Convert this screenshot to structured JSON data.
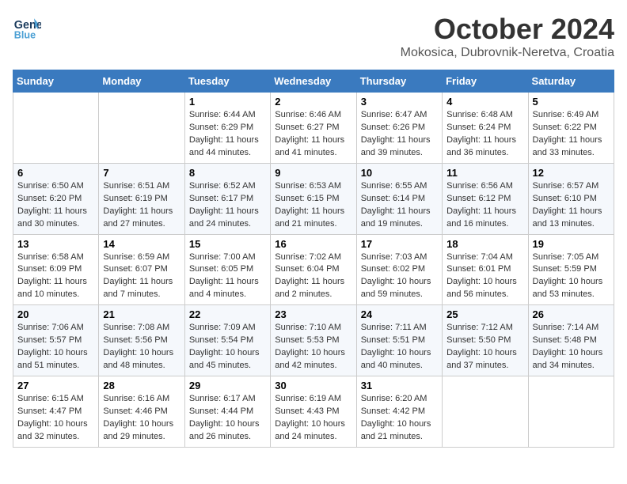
{
  "header": {
    "logo_line1": "General",
    "logo_line2": "Blue",
    "title": "October 2024",
    "location": "Mokosica, Dubrovnik-Neretva, Croatia"
  },
  "days_of_week": [
    "Sunday",
    "Monday",
    "Tuesday",
    "Wednesday",
    "Thursday",
    "Friday",
    "Saturday"
  ],
  "weeks": [
    [
      {
        "day": "",
        "sunrise": "",
        "sunset": "",
        "daylight": ""
      },
      {
        "day": "",
        "sunrise": "",
        "sunset": "",
        "daylight": ""
      },
      {
        "day": "1",
        "sunrise": "Sunrise: 6:44 AM",
        "sunset": "Sunset: 6:29 PM",
        "daylight": "Daylight: 11 hours and 44 minutes."
      },
      {
        "day": "2",
        "sunrise": "Sunrise: 6:46 AM",
        "sunset": "Sunset: 6:27 PM",
        "daylight": "Daylight: 11 hours and 41 minutes."
      },
      {
        "day": "3",
        "sunrise": "Sunrise: 6:47 AM",
        "sunset": "Sunset: 6:26 PM",
        "daylight": "Daylight: 11 hours and 39 minutes."
      },
      {
        "day": "4",
        "sunrise": "Sunrise: 6:48 AM",
        "sunset": "Sunset: 6:24 PM",
        "daylight": "Daylight: 11 hours and 36 minutes."
      },
      {
        "day": "5",
        "sunrise": "Sunrise: 6:49 AM",
        "sunset": "Sunset: 6:22 PM",
        "daylight": "Daylight: 11 hours and 33 minutes."
      }
    ],
    [
      {
        "day": "6",
        "sunrise": "Sunrise: 6:50 AM",
        "sunset": "Sunset: 6:20 PM",
        "daylight": "Daylight: 11 hours and 30 minutes."
      },
      {
        "day": "7",
        "sunrise": "Sunrise: 6:51 AM",
        "sunset": "Sunset: 6:19 PM",
        "daylight": "Daylight: 11 hours and 27 minutes."
      },
      {
        "day": "8",
        "sunrise": "Sunrise: 6:52 AM",
        "sunset": "Sunset: 6:17 PM",
        "daylight": "Daylight: 11 hours and 24 minutes."
      },
      {
        "day": "9",
        "sunrise": "Sunrise: 6:53 AM",
        "sunset": "Sunset: 6:15 PM",
        "daylight": "Daylight: 11 hours and 21 minutes."
      },
      {
        "day": "10",
        "sunrise": "Sunrise: 6:55 AM",
        "sunset": "Sunset: 6:14 PM",
        "daylight": "Daylight: 11 hours and 19 minutes."
      },
      {
        "day": "11",
        "sunrise": "Sunrise: 6:56 AM",
        "sunset": "Sunset: 6:12 PM",
        "daylight": "Daylight: 11 hours and 16 minutes."
      },
      {
        "day": "12",
        "sunrise": "Sunrise: 6:57 AM",
        "sunset": "Sunset: 6:10 PM",
        "daylight": "Daylight: 11 hours and 13 minutes."
      }
    ],
    [
      {
        "day": "13",
        "sunrise": "Sunrise: 6:58 AM",
        "sunset": "Sunset: 6:09 PM",
        "daylight": "Daylight: 11 hours and 10 minutes."
      },
      {
        "day": "14",
        "sunrise": "Sunrise: 6:59 AM",
        "sunset": "Sunset: 6:07 PM",
        "daylight": "Daylight: 11 hours and 7 minutes."
      },
      {
        "day": "15",
        "sunrise": "Sunrise: 7:00 AM",
        "sunset": "Sunset: 6:05 PM",
        "daylight": "Daylight: 11 hours and 4 minutes."
      },
      {
        "day": "16",
        "sunrise": "Sunrise: 7:02 AM",
        "sunset": "Sunset: 6:04 PM",
        "daylight": "Daylight: 11 hours and 2 minutes."
      },
      {
        "day": "17",
        "sunrise": "Sunrise: 7:03 AM",
        "sunset": "Sunset: 6:02 PM",
        "daylight": "Daylight: 10 hours and 59 minutes."
      },
      {
        "day": "18",
        "sunrise": "Sunrise: 7:04 AM",
        "sunset": "Sunset: 6:01 PM",
        "daylight": "Daylight: 10 hours and 56 minutes."
      },
      {
        "day": "19",
        "sunrise": "Sunrise: 7:05 AM",
        "sunset": "Sunset: 5:59 PM",
        "daylight": "Daylight: 10 hours and 53 minutes."
      }
    ],
    [
      {
        "day": "20",
        "sunrise": "Sunrise: 7:06 AM",
        "sunset": "Sunset: 5:57 PM",
        "daylight": "Daylight: 10 hours and 51 minutes."
      },
      {
        "day": "21",
        "sunrise": "Sunrise: 7:08 AM",
        "sunset": "Sunset: 5:56 PM",
        "daylight": "Daylight: 10 hours and 48 minutes."
      },
      {
        "day": "22",
        "sunrise": "Sunrise: 7:09 AM",
        "sunset": "Sunset: 5:54 PM",
        "daylight": "Daylight: 10 hours and 45 minutes."
      },
      {
        "day": "23",
        "sunrise": "Sunrise: 7:10 AM",
        "sunset": "Sunset: 5:53 PM",
        "daylight": "Daylight: 10 hours and 42 minutes."
      },
      {
        "day": "24",
        "sunrise": "Sunrise: 7:11 AM",
        "sunset": "Sunset: 5:51 PM",
        "daylight": "Daylight: 10 hours and 40 minutes."
      },
      {
        "day": "25",
        "sunrise": "Sunrise: 7:12 AM",
        "sunset": "Sunset: 5:50 PM",
        "daylight": "Daylight: 10 hours and 37 minutes."
      },
      {
        "day": "26",
        "sunrise": "Sunrise: 7:14 AM",
        "sunset": "Sunset: 5:48 PM",
        "daylight": "Daylight: 10 hours and 34 minutes."
      }
    ],
    [
      {
        "day": "27",
        "sunrise": "Sunrise: 6:15 AM",
        "sunset": "Sunset: 4:47 PM",
        "daylight": "Daylight: 10 hours and 32 minutes."
      },
      {
        "day": "28",
        "sunrise": "Sunrise: 6:16 AM",
        "sunset": "Sunset: 4:46 PM",
        "daylight": "Daylight: 10 hours and 29 minutes."
      },
      {
        "day": "29",
        "sunrise": "Sunrise: 6:17 AM",
        "sunset": "Sunset: 4:44 PM",
        "daylight": "Daylight: 10 hours and 26 minutes."
      },
      {
        "day": "30",
        "sunrise": "Sunrise: 6:19 AM",
        "sunset": "Sunset: 4:43 PM",
        "daylight": "Daylight: 10 hours and 24 minutes."
      },
      {
        "day": "31",
        "sunrise": "Sunrise: 6:20 AM",
        "sunset": "Sunset: 4:42 PM",
        "daylight": "Daylight: 10 hours and 21 minutes."
      },
      {
        "day": "",
        "sunrise": "",
        "sunset": "",
        "daylight": ""
      },
      {
        "day": "",
        "sunrise": "",
        "sunset": "",
        "daylight": ""
      }
    ]
  ]
}
